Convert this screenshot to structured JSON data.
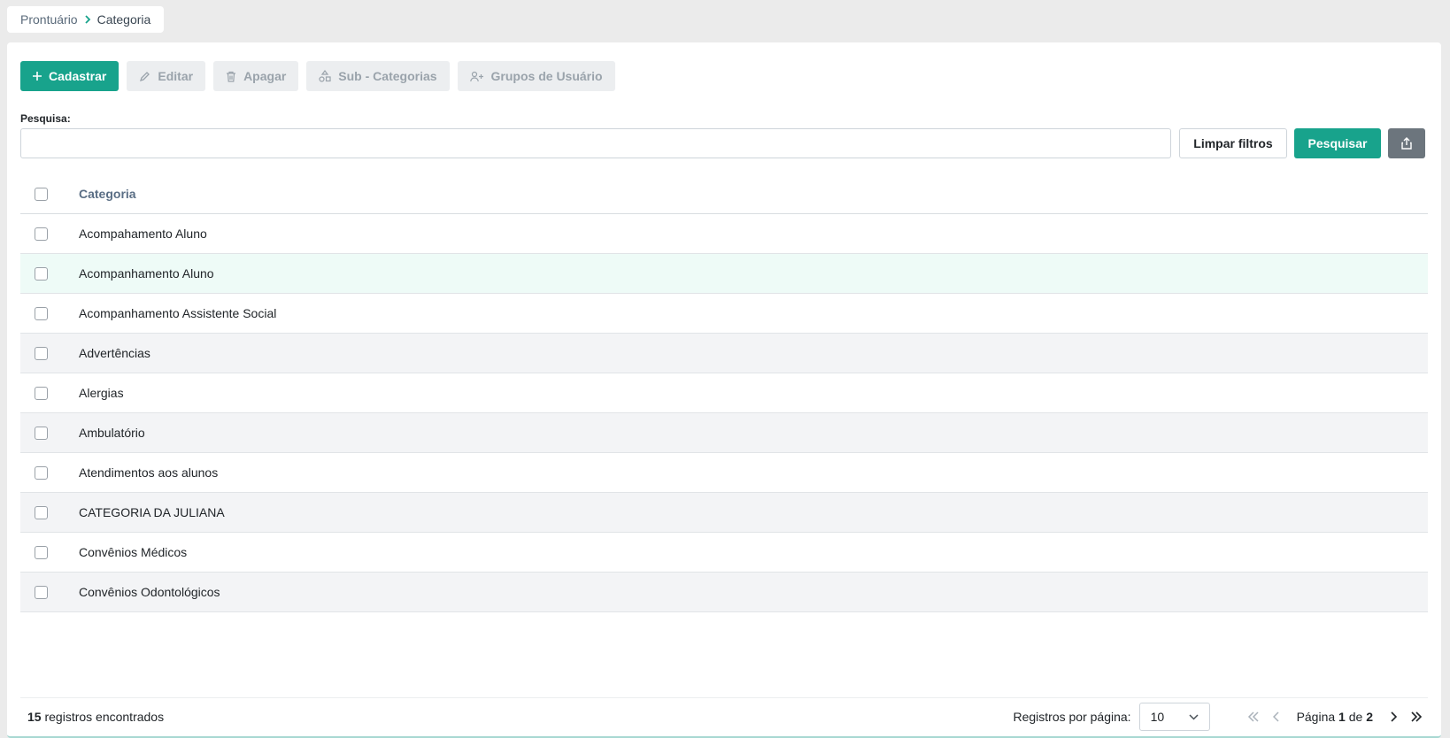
{
  "breadcrumb": {
    "parent": "Prontuário",
    "current": "Categoria"
  },
  "toolbar": {
    "cadastrar": "Cadastrar",
    "editar": "Editar",
    "apagar": "Apagar",
    "subcategorias": "Sub - Categorias",
    "grupos": "Grupos de Usuário"
  },
  "search": {
    "label": "Pesquisa:",
    "value": "",
    "placeholder": "",
    "clear_label": "Limpar filtros",
    "search_label": "Pesquisar"
  },
  "table": {
    "column": "Categoria",
    "rows": [
      "Acompahamento Aluno",
      "Acompanhamento Aluno",
      "Acompanhamento Assistente Social",
      "Advertências",
      "Alergias",
      "Ambulatório",
      "Atendimentos aos alunos",
      "CATEGORIA DA JULIANA",
      "Convênios Médicos",
      "Convênios Odontológicos"
    ]
  },
  "footer": {
    "count": "15",
    "count_label": "registros encontrados",
    "per_page_label": "Registros por página:",
    "per_page": "10",
    "page_word": "Página",
    "page": "1",
    "of_word": "de",
    "total_pages": "2"
  },
  "colors": {
    "accent": "#18a38c",
    "export": "#6c757d"
  }
}
